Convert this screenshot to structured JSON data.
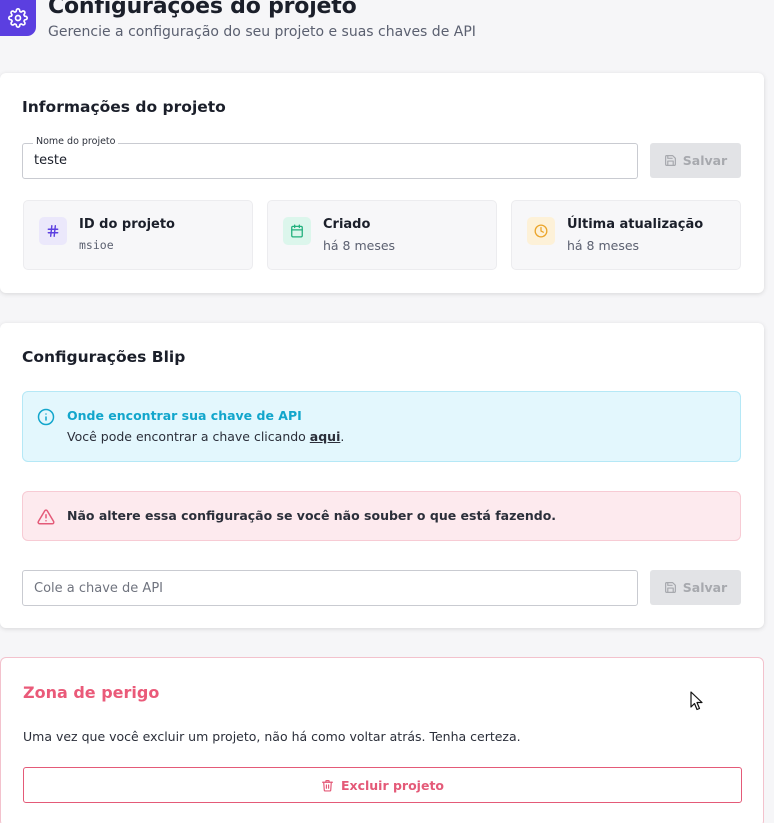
{
  "header": {
    "title": "Configurações do projeto",
    "subtitle": "Gerencie a configuração do seu projeto e suas chaves de API",
    "icon": "gear-icon",
    "icon_bg": "#5b3fe0"
  },
  "project_info": {
    "title": "Informações do projeto",
    "name_field": {
      "legend": "Nome do projeto",
      "value": "teste"
    },
    "save_label": "Salvar",
    "tiles": [
      {
        "icon": "hash-icon",
        "label": "ID do projeto",
        "value": "msioe"
      },
      {
        "icon": "calendar-icon",
        "label": "Criado",
        "value": "há 8 meses"
      },
      {
        "icon": "clock-icon",
        "label": "Última atualização",
        "value": "há 8 meses"
      }
    ]
  },
  "blip": {
    "title": "Configurações Blip",
    "info_alert": {
      "title": "Onde encontrar sua chave de API",
      "body_prefix": "Você pode encontrar a chave clicando ",
      "link": "aqui",
      "body_suffix": "."
    },
    "warning_alert": {
      "text": "Não altere essa configuração se você não souber o que está fazendo."
    },
    "api_key_placeholder": "Cole a chave de API",
    "save_label": "Salvar"
  },
  "danger_zone": {
    "title": "Zona de perigo",
    "text": "Uma vez que você excluir um projeto, não há como voltar atrás. Tenha certeza.",
    "delete_label": "Excluir projeto"
  },
  "colors": {
    "accent": "#5b3fe0",
    "danger": "#e45a78",
    "info": "#12a6cc",
    "warning_bg": "#fdeaee",
    "info_bg": "#e3f7fd"
  }
}
